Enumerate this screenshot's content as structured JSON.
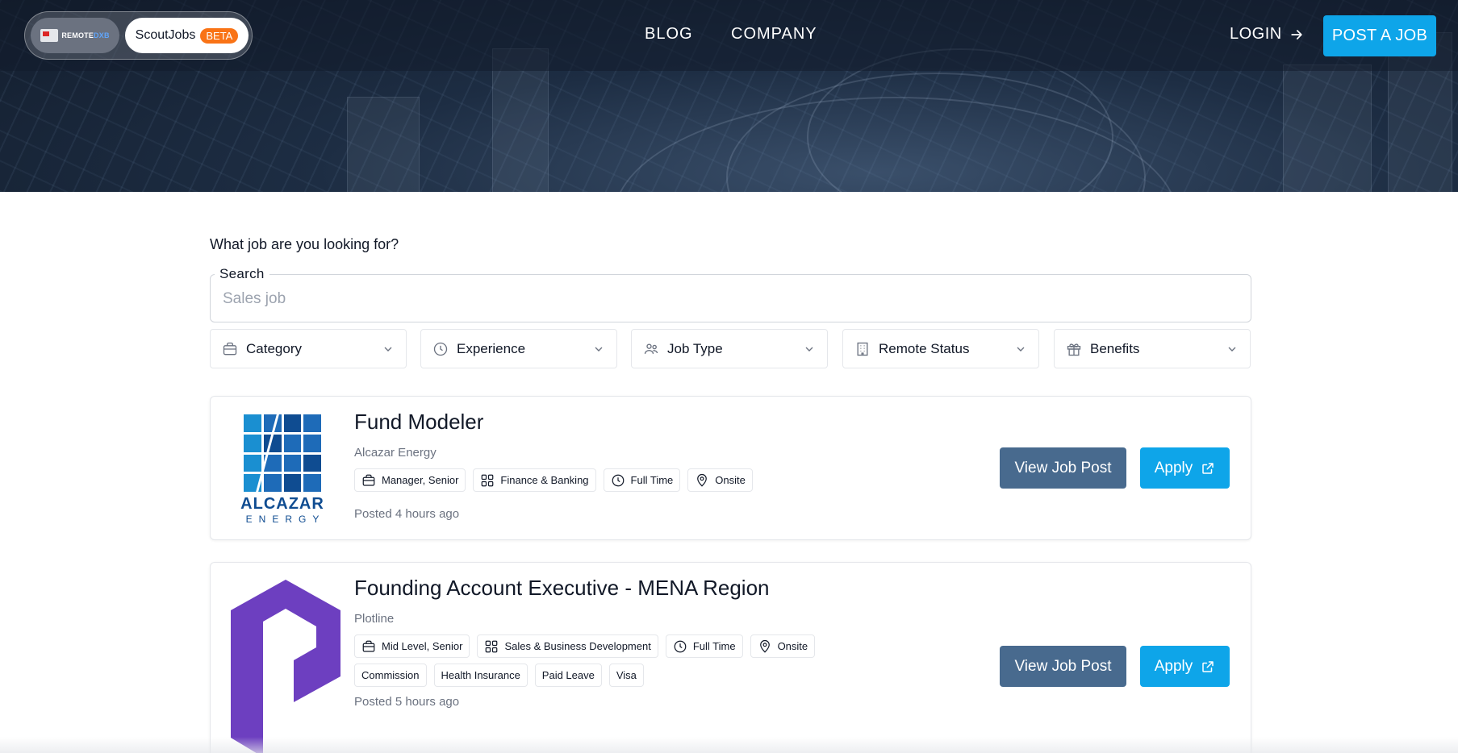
{
  "header": {
    "brand_logo_text_a": "REMOTE",
    "brand_logo_text_b": "DXB",
    "scout_name": "ScoutJobs",
    "beta_badge": "BETA",
    "nav": {
      "blog": "BLOG",
      "company": "COMPANY"
    },
    "login": "LOGIN",
    "post_job": "POST A JOB"
  },
  "search": {
    "question": "What job are you looking for?",
    "label": "Search",
    "placeholder": "Sales job",
    "value": ""
  },
  "filters": [
    {
      "label": "Category",
      "icon": "briefcase-icon"
    },
    {
      "label": "Experience",
      "icon": "clock-icon"
    },
    {
      "label": "Job Type",
      "icon": "users-icon"
    },
    {
      "label": "Remote Status",
      "icon": "building-icon"
    },
    {
      "label": "Benefits",
      "icon": "gift-icon"
    }
  ],
  "jobs": [
    {
      "title": "Fund Modeler",
      "company": "Alcazar Energy",
      "logo_text": "ALCAZAR",
      "logo_subtext": "ENERGY",
      "tags": {
        "level": "Manager, Senior",
        "category": "Finance & Banking",
        "type": "Full Time",
        "location": "Onsite"
      },
      "benefits": [],
      "posted": "Posted 4 hours ago",
      "view_label": "View Job Post",
      "apply_label": "Apply"
    },
    {
      "title": "Founding Account Executive - MENA Region",
      "company": "Plotline",
      "tags": {
        "level": "Mid Level, Senior",
        "category": "Sales & Business Development",
        "type": "Full Time",
        "location": "Onsite"
      },
      "benefits": [
        "Commission",
        "Health Insurance",
        "Paid Leave",
        "Visa"
      ],
      "posted": "Posted 5 hours ago",
      "view_label": "View Job Post",
      "apply_label": "Apply"
    }
  ],
  "colors": {
    "primary": "#0ea5e9",
    "secondary_button": "#486a8e",
    "beta": "#f97316",
    "plotline_purple": "#6d3fc0",
    "alcazar_blue": "#0f4c91"
  }
}
